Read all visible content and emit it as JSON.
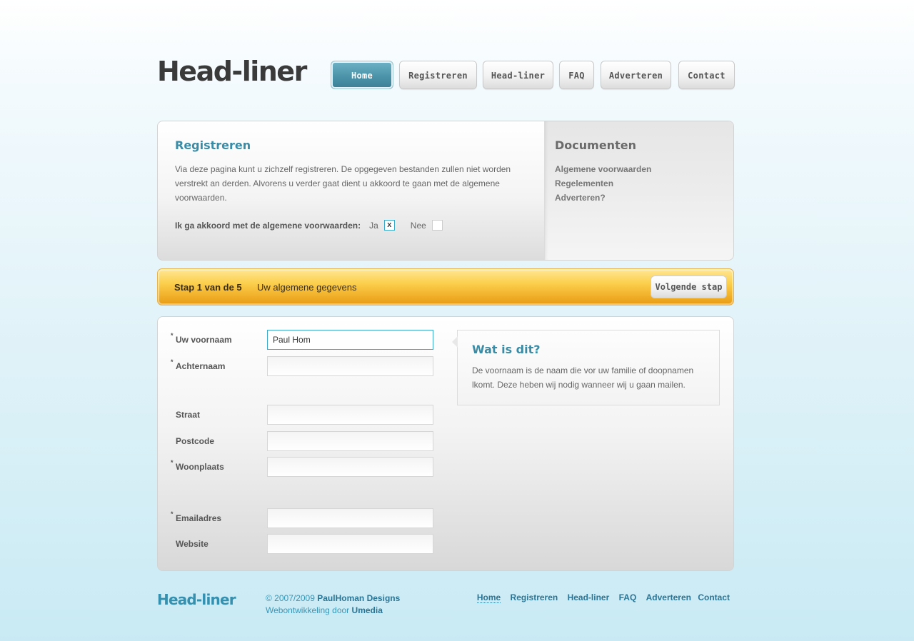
{
  "brand": {
    "logo": "Head-liner"
  },
  "nav": {
    "items": [
      {
        "label": "Home",
        "active": true
      },
      {
        "label": "Registreren"
      },
      {
        "label": "Head-liner"
      },
      {
        "label": "FAQ"
      },
      {
        "label": "Adverteren"
      },
      {
        "label": "Contact"
      }
    ]
  },
  "intro": {
    "title": "Registreren",
    "text": "Via deze pagina kunt u zichzelf registreren. De opgegeven bestanden zullen niet worden verstrekt an derden. Alvorens u verder gaat dient u akkoord te gaan met de algemene voorwaarden.",
    "agree_label": "Ik ga akkoord met de algemene voorwaarden:",
    "yes_label": "Ja",
    "yes_checked_mark": "x",
    "no_label": "Nee"
  },
  "documents": {
    "title": "Documenten",
    "items": [
      "Algemene voorwaarden",
      "Regelementen",
      "Adverteren?"
    ]
  },
  "step": {
    "number_label": "Stap 1 van de 5",
    "title": "Uw algemene gegevens",
    "next_label": "Volgende stap"
  },
  "form": {
    "required_mark": "*",
    "fields": [
      {
        "label": "Uw voornaam",
        "value": "Paul Hom",
        "required": true
      },
      {
        "label": "Achternaam",
        "value": "",
        "required": true
      },
      {
        "label": "Straat",
        "value": "",
        "required": false
      },
      {
        "label": "Postcode",
        "value": "",
        "required": false
      },
      {
        "label": "Woonplaats",
        "value": "",
        "required": true
      },
      {
        "label": "Emailadres",
        "value": "",
        "required": true
      },
      {
        "label": "Website",
        "value": "",
        "required": false
      }
    ]
  },
  "help": {
    "title": "Wat is dit?",
    "text": "De voornaam is de naam die vor uw familie of doopnamen lkomt. Deze heben wij nodig wanneer wij u gaan mailen."
  },
  "footer": {
    "logo": "Head-liner",
    "copyright_prefix": "© 2007/2009",
    "copyright_owner": "PaulHoman Designs",
    "dev_prefix": "Webontwikkeling door",
    "dev_owner": "Umedia",
    "links": [
      "Home",
      "Registreren",
      "Head-liner",
      "FAQ",
      "Adverteren",
      "Contact"
    ]
  }
}
